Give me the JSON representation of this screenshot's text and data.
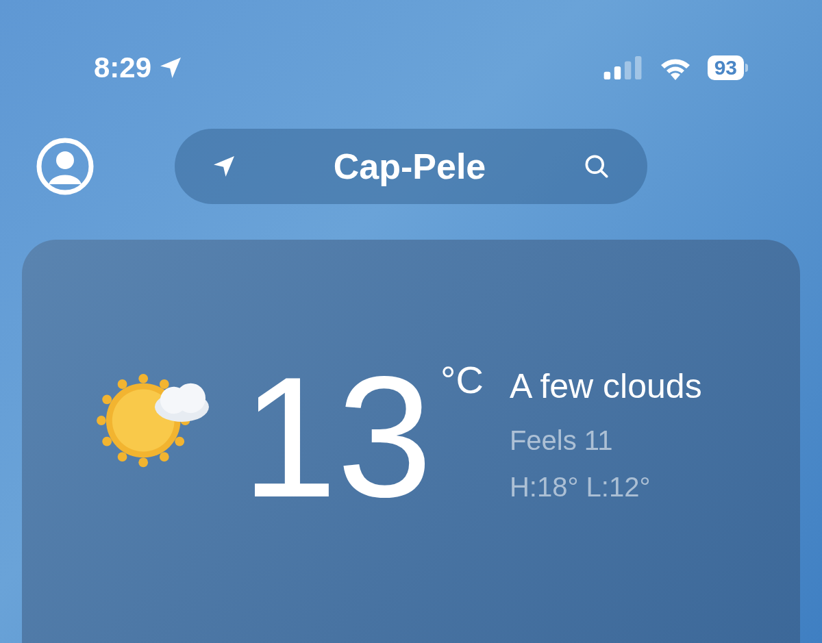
{
  "status_bar": {
    "time": "8:29",
    "battery": "93"
  },
  "location_bar": {
    "city": "Cap-Pele"
  },
  "current": {
    "temperature": "13",
    "unit": "°C",
    "condition": "A few clouds",
    "feels_like": "Feels 11",
    "high_low": "H:18° L:12°"
  }
}
